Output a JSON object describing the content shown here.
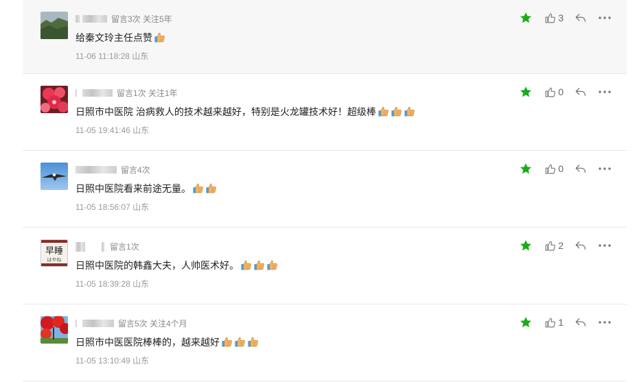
{
  "colors": {
    "star": "#1aad19",
    "divider": "#e8e8e8",
    "first_bg": "#f7f7f7"
  },
  "comments": [
    {
      "avatar": "mountain-landscape",
      "meta": "留言3次 关注5年",
      "text": "给秦文玲主任点赞",
      "thumbs": 1,
      "time": "11-06 11:18:28 山东",
      "likes": "3"
    },
    {
      "avatar": "red-flowers",
      "meta": "留言1次 关注1年",
      "text": "日照市中医院 治病救人的技术越来越好，特别是火龙罐技术好！超级棒",
      "thumbs": 3,
      "time": "11-05 19:41:46 山东",
      "likes": "0"
    },
    {
      "avatar": "eagle-sky",
      "meta": "留言4次",
      "text": "日照中医院看来前途无量。",
      "thumbs": 2,
      "time": "11-05 18:56:07 山东",
      "likes": "0"
    },
    {
      "avatar": "calligraphy-sign",
      "avatar_text": "早睡",
      "avatar_sub": "はやね",
      "meta": "留言1次",
      "text": "日照中医院的韩鑫大夫，人帅医术好。",
      "thumbs": 3,
      "time": "11-05 18:39:28 山东",
      "likes": "2"
    },
    {
      "avatar": "red-maple",
      "meta": "留言5次 关注4个月",
      "text": "日照市中医医院棒棒的，越来越好",
      "thumbs": 3,
      "time": "11-05 13:10:49 山东",
      "likes": "1"
    }
  ]
}
